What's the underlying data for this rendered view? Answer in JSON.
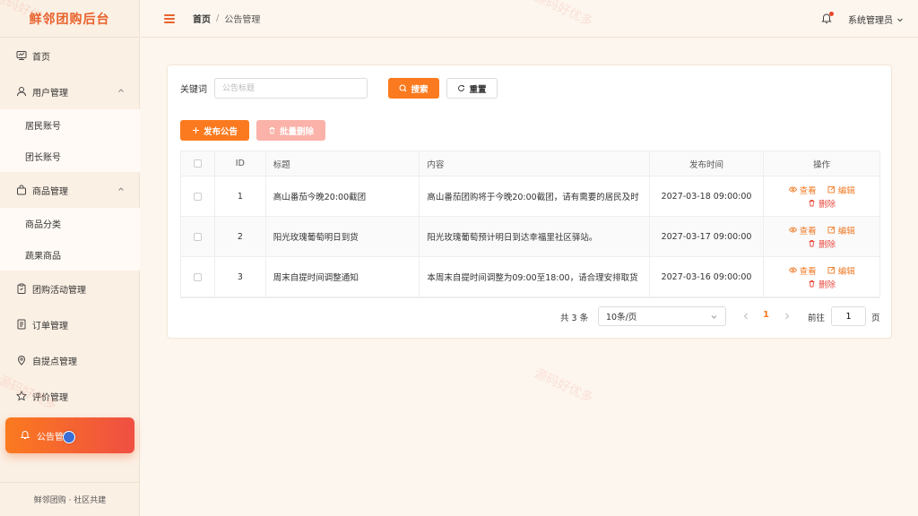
{
  "app": {
    "brand": "鲜邻团购后台",
    "footer": "鲜邻团购 · 社区共建"
  },
  "sidebar": {
    "items": [
      {
        "label": "首页",
        "icon": "monitor-icon"
      },
      {
        "label": "用户管理",
        "icon": "user-icon",
        "expanded": true
      },
      {
        "label": "居民账号"
      },
      {
        "label": "团长账号"
      },
      {
        "label": "商品管理",
        "icon": "bag-icon",
        "expanded": true
      },
      {
        "label": "商品分类"
      },
      {
        "label": "蔬果商品"
      },
      {
        "label": "团购活动管理",
        "icon": "clipboard-icon"
      },
      {
        "label": "订单管理",
        "icon": "document-icon"
      },
      {
        "label": "自提点管理",
        "icon": "location-icon"
      },
      {
        "label": "评价管理",
        "icon": "star-icon"
      },
      {
        "label": "公告管理",
        "icon": "bell-icon",
        "active": true
      }
    ]
  },
  "header": {
    "breadcrumb": [
      "首页",
      "公告管理"
    ],
    "breadcrumb_sep": "/",
    "user": "系统管理员"
  },
  "search": {
    "label": "关键词",
    "placeholder": "公告标题",
    "search_btn": "搜索",
    "reset_btn": "重置"
  },
  "toolbar": {
    "add_btn": "发布公告",
    "batch_delete_btn": "批量删除"
  },
  "table": {
    "headers": {
      "id": "ID",
      "title": "标题",
      "content": "内容",
      "time": "发布时间",
      "ops": "操作"
    },
    "rows": [
      {
        "id": "1",
        "title": "高山番茄今晚20:00截团",
        "content": "高山番茄团购将于今晚20:00截团，请有需要的居民及时",
        "time": "2027-03-18 09:00:00"
      },
      {
        "id": "2",
        "title": "阳光玫瑰葡萄明日到货",
        "content": "阳光玫瑰葡萄预计明日到达幸福里社区驿站。",
        "time": "2027-03-17 09:00:00"
      },
      {
        "id": "3",
        "title": "周末自提时间调整通知",
        "content": "本周末自提时间调整为09:00至18:00，请合理安排取货",
        "time": "2027-03-16 09:00:00"
      }
    ],
    "ops": {
      "view": "查看",
      "edit": "编辑",
      "delete": "删除"
    }
  },
  "pagination": {
    "total": "共 3 条",
    "page_size": "10条/页",
    "current": "1",
    "goto_label": "前往",
    "goto_value": "1",
    "page_suffix": "页"
  },
  "watermark": "源码好优多",
  "colors": {
    "accent": "#fb7a1f",
    "danger": "#ea4a3f",
    "brand": "#e8612a"
  }
}
